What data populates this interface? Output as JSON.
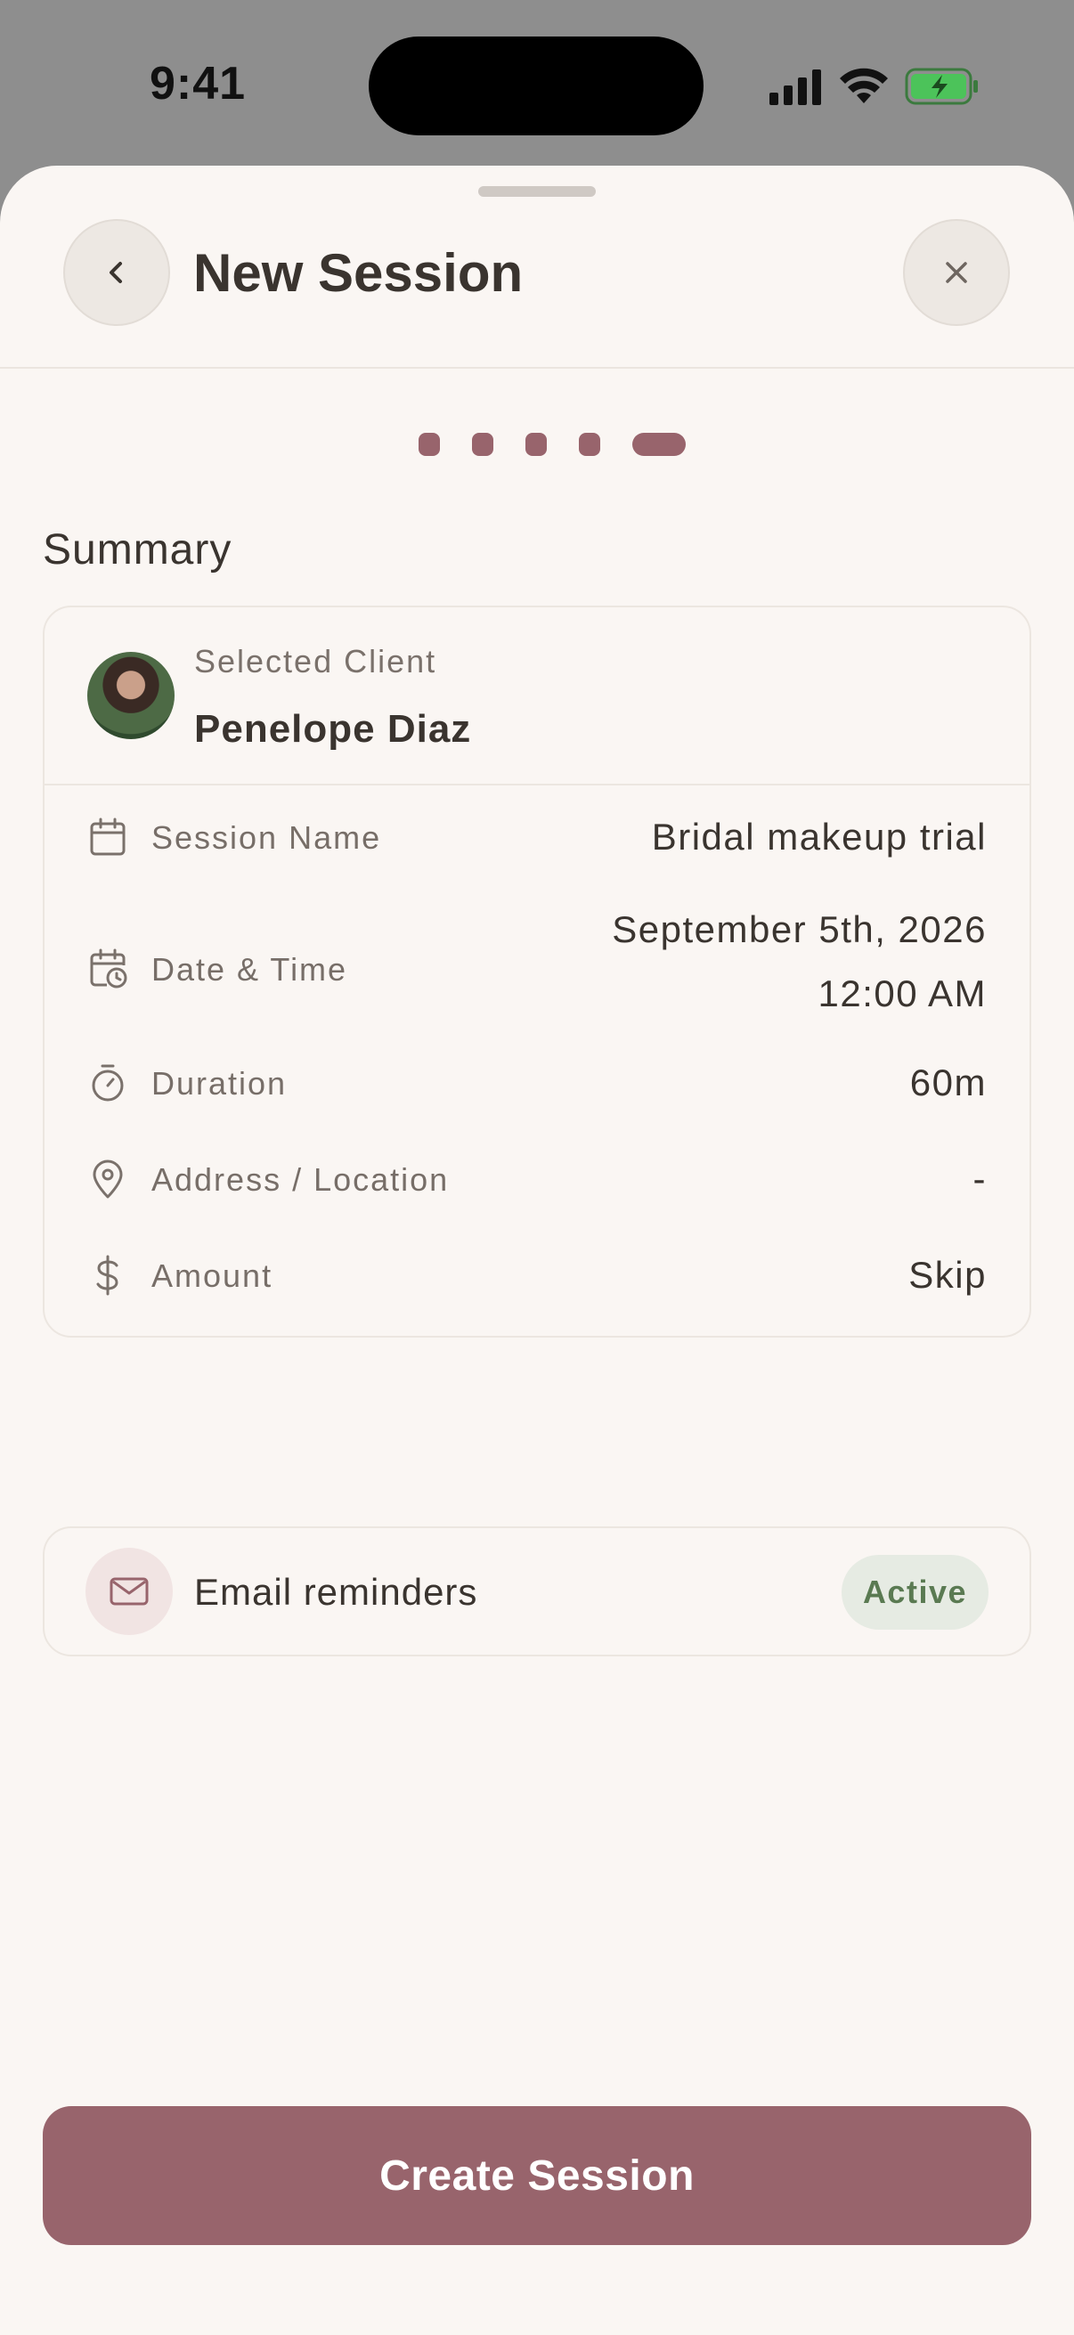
{
  "status_bar": {
    "time": "9:41"
  },
  "header": {
    "title": "New Session"
  },
  "stepper": {
    "total_steps": 5,
    "current_step": 5
  },
  "summary": {
    "section_title": "Summary",
    "client": {
      "label": "Selected Client",
      "name": "Penelope Diaz"
    },
    "rows": [
      {
        "icon": "calendar-icon",
        "label": "Session Name",
        "value": "Bridal makeup trial"
      },
      {
        "icon": "calendar-clock-icon",
        "label": "Date & Time",
        "value_line1": "September 5th, 2026",
        "value_line2": "12:00 AM"
      },
      {
        "icon": "timer-icon",
        "label": "Duration",
        "value": "60m"
      },
      {
        "icon": "location-pin-icon",
        "label": "Address / Location",
        "value": "-"
      },
      {
        "icon": "dollar-icon",
        "label": "Amount",
        "value": "Skip"
      }
    ]
  },
  "reminders": {
    "icon": "mail-icon",
    "label": "Email reminders",
    "status": "Active"
  },
  "actions": {
    "create_label": "Create Session"
  },
  "colors": {
    "accent": "#98646c",
    "background": "#faf6f3",
    "active_badge_bg": "#e6ebe3",
    "active_badge_text": "#5a7a52"
  }
}
